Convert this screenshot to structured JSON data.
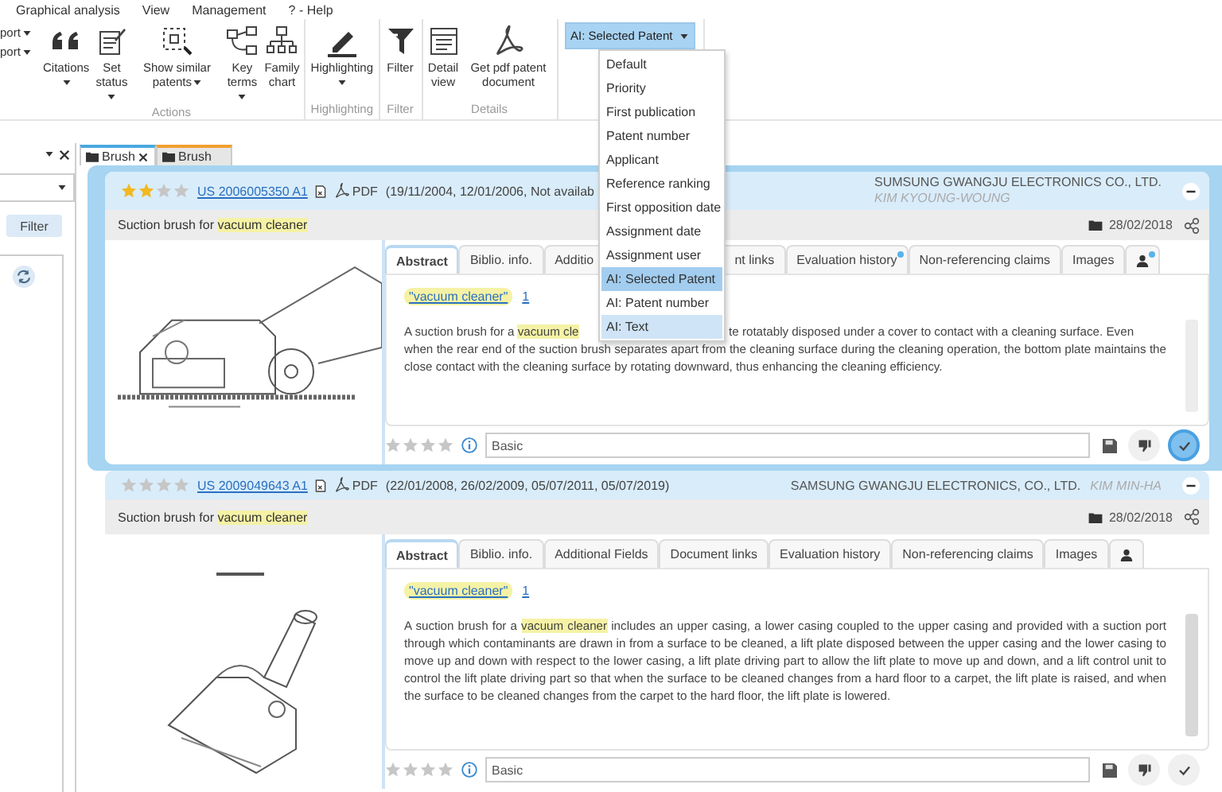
{
  "menu_bar": [
    "Graphical analysis",
    "View",
    "Management",
    "? - Help"
  ],
  "ribbon": {
    "cut_items": [
      {
        "label": "port",
        "caret": true
      },
      {
        "label": "port",
        "caret": true
      }
    ],
    "groups": [
      {
        "label": "Actions",
        "buttons": [
          {
            "label": "Citations",
            "caret": true
          },
          {
            "label": "Set status",
            "caret": true
          },
          {
            "label": "Show similar patents",
            "caret": true
          },
          {
            "label": "Key terms",
            "caret": true
          },
          {
            "label": "Family chart",
            "caret": false
          }
        ]
      },
      {
        "label": "Highlighting",
        "buttons": [
          {
            "label": "Highlighting",
            "caret": true
          }
        ]
      },
      {
        "label": "Filter",
        "buttons": [
          {
            "label": "Filter",
            "caret": false
          }
        ]
      },
      {
        "label": "Details",
        "buttons": [
          {
            "label": "Detail view",
            "caret": false
          },
          {
            "label": "Get pdf patent document",
            "caret": false
          }
        ]
      }
    ]
  },
  "sort_dropdown": {
    "value": "AI: Selected Patent",
    "expanded": true,
    "options": [
      {
        "label": "Default",
        "selected": false,
        "hovered": false
      },
      {
        "label": "Priority",
        "selected": false,
        "hovered": false
      },
      {
        "label": "First publication",
        "selected": false,
        "hovered": false
      },
      {
        "label": "Patent number",
        "selected": false,
        "hovered": false
      },
      {
        "label": "Applicant",
        "selected": false,
        "hovered": false
      },
      {
        "label": "Reference ranking",
        "selected": false,
        "hovered": false
      },
      {
        "label": "First opposition date",
        "selected": false,
        "hovered": false
      },
      {
        "label": "Assignment date",
        "selected": false,
        "hovered": false
      },
      {
        "label": "Assignment user",
        "selected": false,
        "hovered": false
      },
      {
        "label": "AI: Selected Patent",
        "selected": true,
        "hovered": false
      },
      {
        "label": "AI: Patent number",
        "selected": false,
        "hovered": false
      },
      {
        "label": "AI: Text",
        "selected": false,
        "hovered": true
      }
    ]
  },
  "left_panel": {
    "filter_button": "Filter"
  },
  "doc_tabs": [
    {
      "label": "Brush",
      "selected": true,
      "closable": true,
      "color": "#4aa8e0"
    },
    {
      "label": "Brush",
      "selected": false,
      "closable": false,
      "color": "#f0a030"
    }
  ],
  "results": [
    {
      "selected": true,
      "stars": 2,
      "number": "US 2006005350 A1",
      "pdf_label": "PDF",
      "dates": "(19/11/2004, 12/01/2006, Not availab",
      "applicant": "SUMSUNG GWANGJU ELECTRONICS CO., LTD.",
      "inventor": "KIM KYOUNG-WOUNG",
      "title": "Suction brush for **vacuum cleaner**",
      "folder_date": "28/02/2018",
      "tabs": [
        {
          "kind": "text",
          "label": "Abstract",
          "selected": true,
          "dot": false
        },
        {
          "kind": "text",
          "label": "Biblio. info.",
          "selected": false,
          "dot": false
        },
        {
          "kind": "cut_end",
          "label": "Additio",
          "selected": false
        },
        {
          "kind": "cut_start",
          "label": "nt links",
          "selected": false
        },
        {
          "kind": "text",
          "label": "Evaluation history",
          "selected": false,
          "dot": true
        },
        {
          "kind": "text",
          "label": "Non-referencing claims",
          "selected": false,
          "dot": false
        },
        {
          "kind": "text",
          "label": "Images",
          "selected": false,
          "dot": false
        },
        {
          "kind": "person",
          "selected": false,
          "dot": true
        }
      ],
      "term": "\"vacuum cleaner\"",
      "term_count": "1",
      "abstract": [
        {
          "kind": "line_start",
          "text": "A suction brush for a **vacuum cle**"
        },
        {
          "kind": "line_end",
          "text": "te rotatably disposed under a cover to contact with a cleaning surface. Even"
        },
        {
          "kind": "block",
          "text": "when the rear end of the suction brush separates apart from the cleaning surface during the cleaning operation, the bottom plate maintains the close contact with the cleaning surface by rotating downward, thus enhancing the cleaning efficiency."
        }
      ],
      "review": {
        "stars": 0,
        "comment": "Basic",
        "confirmed": true
      }
    },
    {
      "selected": false,
      "stars": 0,
      "number": "US 2009049643 A1",
      "pdf_label": "PDF",
      "dates": "(22/01/2008, 26/02/2009, 05/07/2011, 05/07/2019)",
      "applicant": "SAMSUNG GWANGJU ELECTRONICS, CO., LTD.",
      "inventor": "KIM MIN-HA",
      "title": "Suction brush for **vacuum cleaner**",
      "folder_date": "28/02/2018",
      "tabs": [
        {
          "kind": "text",
          "label": "Abstract",
          "selected": true,
          "dot": false
        },
        {
          "kind": "text",
          "label": "Biblio. info.",
          "selected": false,
          "dot": false
        },
        {
          "kind": "text",
          "label": "Additional Fields",
          "selected": false,
          "dot": false
        },
        {
          "kind": "text",
          "label": "Document links",
          "selected": false,
          "dot": false
        },
        {
          "kind": "text",
          "label": "Evaluation history",
          "selected": false,
          "dot": false
        },
        {
          "kind": "text",
          "label": "Non-referencing claims",
          "selected": false,
          "dot": false
        },
        {
          "kind": "text",
          "label": "Images",
          "selected": false,
          "dot": false
        },
        {
          "kind": "person",
          "selected": false,
          "dot": false
        }
      ],
      "term": "\"vacuum cleaner\"",
      "term_count": "1",
      "abstract": [
        {
          "kind": "block",
          "text": "A suction brush for a **vacuum cleaner** includes an upper casing, a lower casing coupled to the upper casing and provided with a suction port through which contaminants are drawn in from a surface to be cleaned, a lift plate disposed between the upper casing and the lower casing to move up and down with respect to the lower casing, a lift plate driving part to allow the lift plate to move up and down, and a lift control unit to control the lift plate driving part so that when the surface to be cleaned changes from a hard floor to a carpet, the lift plate is raised, and when the surface to be cleaned changes from the carpet to the hard floor, the lift plate is lowered."
        }
      ],
      "review": {
        "stars": 0,
        "comment": "Basic",
        "confirmed": false
      }
    }
  ]
}
